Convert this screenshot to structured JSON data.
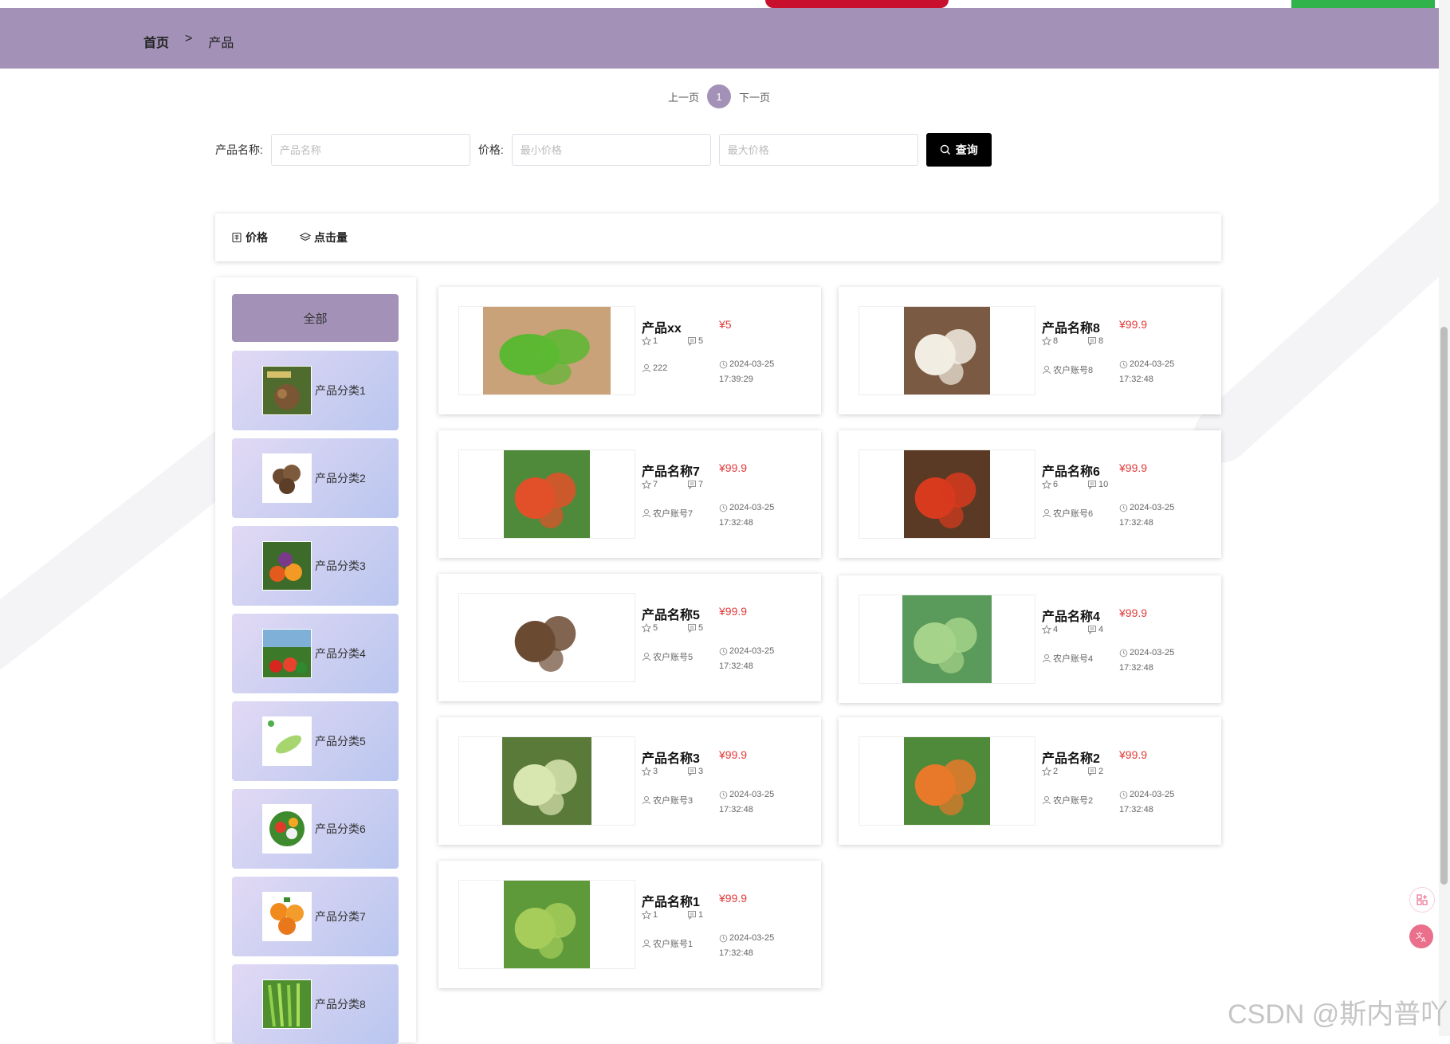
{
  "breadcrumb": {
    "home": "首页",
    "separator": ">",
    "current": "产品"
  },
  "pagination": {
    "prev": "上一页",
    "current": "1",
    "next": "下一页"
  },
  "search": {
    "name_label": "产品名称:",
    "name_placeholder": "产品名称",
    "price_label": "价格:",
    "min_placeholder": "最小价格",
    "max_placeholder": "最大价格",
    "button_label": "查询"
  },
  "sort": {
    "price": "价格",
    "clicks": "点击量"
  },
  "sidebar": {
    "all_label": "全部",
    "categories": [
      {
        "label": "产品分类1"
      },
      {
        "label": "产品分类2"
      },
      {
        "label": "产品分类3"
      },
      {
        "label": "产品分类4"
      },
      {
        "label": "产品分类5"
      },
      {
        "label": "产品分类6"
      },
      {
        "label": "产品分类7"
      },
      {
        "label": "产品分类8"
      }
    ]
  },
  "products": [
    {
      "name": "产品xx",
      "price": "¥5",
      "stars": "1",
      "comments": "5",
      "user": "222",
      "date": "2024-03-25",
      "time": "17:39:29"
    },
    {
      "name": "产品名称8",
      "price": "¥99.9",
      "stars": "8",
      "comments": "8",
      "user": "农户账号8",
      "date": "2024-03-25",
      "time": "17:32:48"
    },
    {
      "name": "产品名称7",
      "price": "¥99.9",
      "stars": "7",
      "comments": "7",
      "user": "农户账号7",
      "date": "2024-03-25",
      "time": "17:32:48"
    },
    {
      "name": "产品名称6",
      "price": "¥99.9",
      "stars": "6",
      "comments": "10",
      "user": "农户账号6",
      "date": "2024-03-25",
      "time": "17:32:48"
    },
    {
      "name": "产品名称5",
      "price": "¥99.9",
      "stars": "5",
      "comments": "5",
      "user": "农户账号5",
      "date": "2024-03-25",
      "time": "17:32:48"
    },
    {
      "name": "产品名称4",
      "price": "¥99.9",
      "stars": "4",
      "comments": "4",
      "user": "农户账号4",
      "date": "2024-03-25",
      "time": "17:32:48"
    },
    {
      "name": "产品名称3",
      "price": "¥99.9",
      "stars": "3",
      "comments": "3",
      "user": "农户账号3",
      "date": "2024-03-25",
      "time": "17:32:48"
    },
    {
      "name": "产品名称2",
      "price": "¥99.9",
      "stars": "2",
      "comments": "2",
      "user": "农户账号2",
      "date": "2024-03-25",
      "time": "17:32:48"
    },
    {
      "name": "产品名称1",
      "price": "¥99.9",
      "stars": "1",
      "comments": "1",
      "user": "农户账号1",
      "date": "2024-03-25",
      "time": "17:32:48"
    }
  ],
  "watermark": "CSDN @斯内普吖",
  "colors": {
    "accent": "#a391b7",
    "price": "#e23a3a",
    "button": "#000000"
  }
}
